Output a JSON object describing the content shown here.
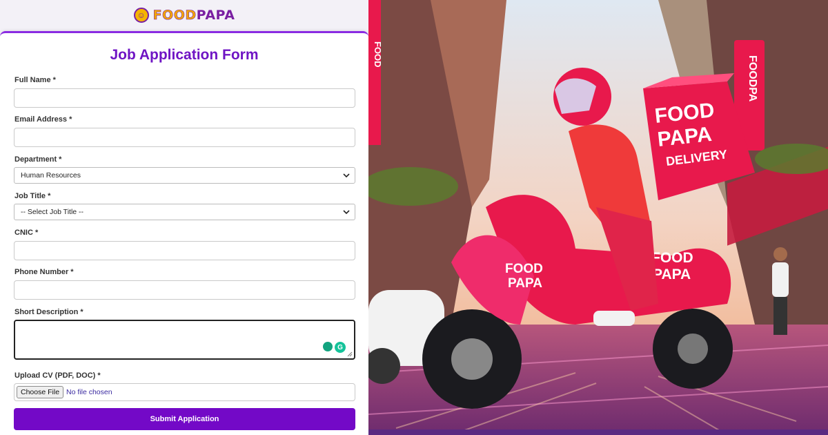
{
  "brand": {
    "logo_text_a": "FOOD",
    "logo_text_b": "PAPA",
    "logo_icon": "chef-mascot-icon"
  },
  "form": {
    "title": "Job Application Form",
    "fields": {
      "full_name": {
        "label": "Full Name *",
        "value": "",
        "placeholder": ""
      },
      "email": {
        "label": "Email Address *",
        "value": "",
        "placeholder": ""
      },
      "department": {
        "label": "Department *",
        "selected": "Human Resources"
      },
      "job_title": {
        "label": "Job Title *",
        "selected": "-- Select Job Title --"
      },
      "cnic": {
        "label": "CNIC *",
        "value": "",
        "placeholder": ""
      },
      "phone": {
        "label": "Phone Number *",
        "value": "",
        "placeholder": ""
      },
      "description": {
        "label": "Short Description *",
        "value": ""
      },
      "cv": {
        "label": "Upload CV (PDF, DOC) *",
        "button": "Choose File",
        "status": "No file chosen"
      }
    },
    "submit_label": "Submit Application"
  },
  "illustration": {
    "box_text_1": "FOOD",
    "box_text_2": "PAPA",
    "box_text_3": "DELIVERY",
    "scooter_text_1": "FOOD",
    "scooter_text_2": "PAPA",
    "sign_left": "FOOD",
    "sign_right": "FOODPA"
  },
  "colors": {
    "accent": "#7309c7",
    "title": "#6f14c4",
    "brand_red": "#e81e4d",
    "brand_yellow": "#f5a800"
  }
}
